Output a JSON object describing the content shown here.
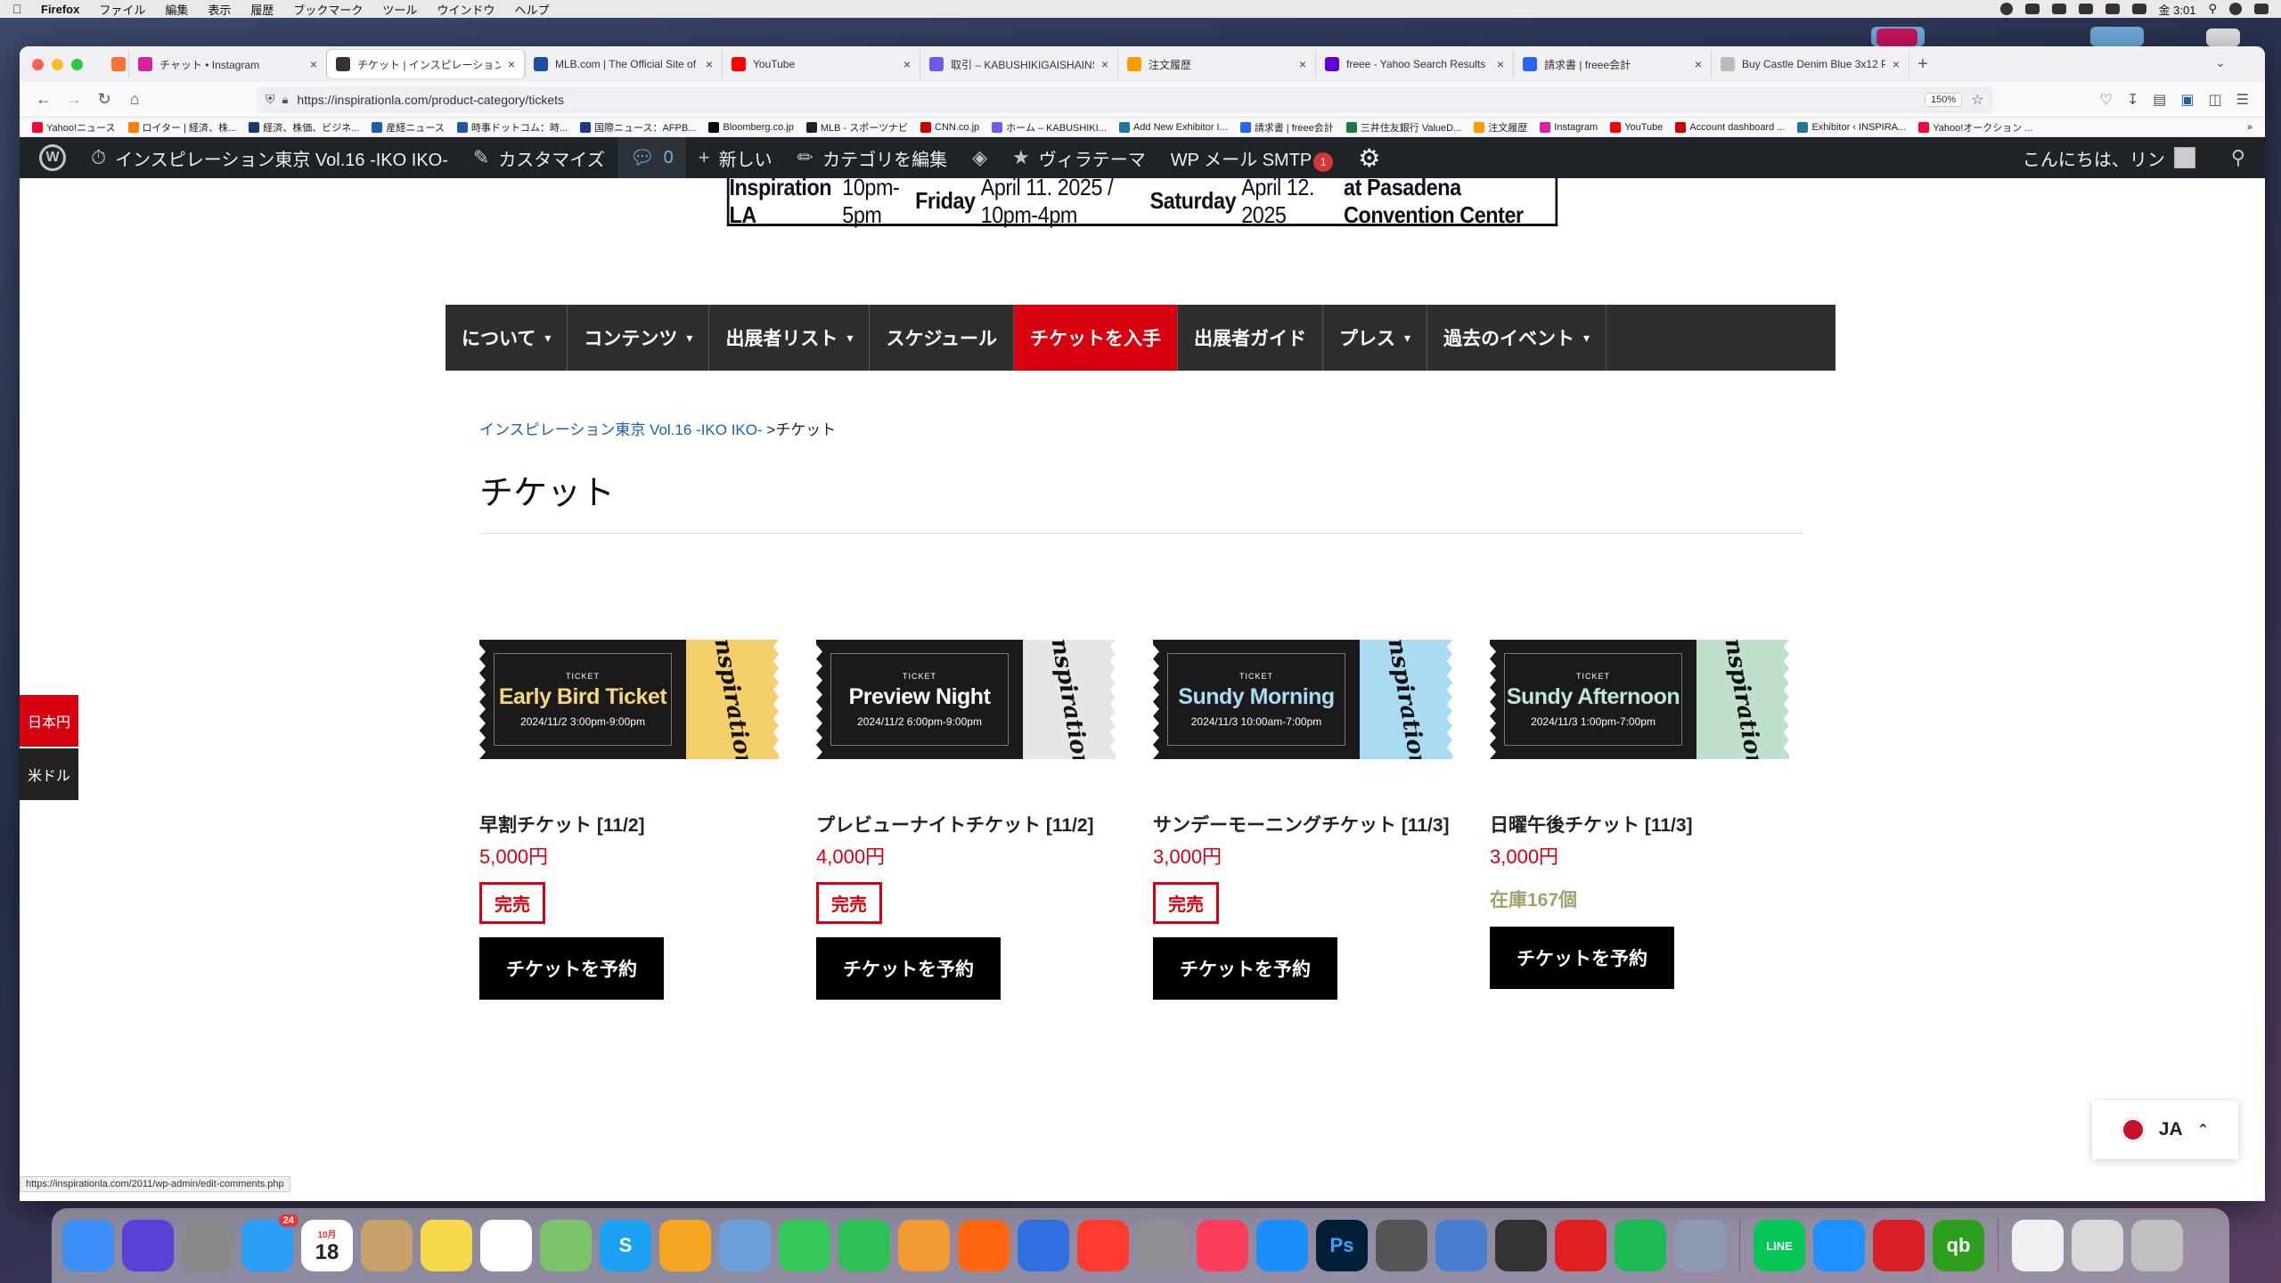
{
  "menubar": {
    "app": "Firefox",
    "menus": [
      "ファイル",
      "編集",
      "表示",
      "履歴",
      "ブックマーク",
      "ツール",
      "ウインドウ",
      "ヘルプ"
    ],
    "clock": "金 3:01"
  },
  "browser": {
    "tabs": [
      {
        "label": "",
        "color": "#ff7139"
      },
      {
        "label": "チャット • Instagram",
        "color": "#d6249f"
      },
      {
        "label": "チケット | インスピレーション東",
        "color": "#333333",
        "active": true
      },
      {
        "label": "MLB.com | The Official Site of M",
        "color": "#1b4f9c"
      },
      {
        "label": "YouTube",
        "color": "#ff0000"
      },
      {
        "label": "取引 – KABUSHIKIGAISHAINSPI",
        "color": "#6b5ce7"
      },
      {
        "label": "注文履歴",
        "color": "#ff9900"
      },
      {
        "label": "freee - Yahoo Search Results",
        "color": "#6001d2"
      },
      {
        "label": "請求書 | freee会計",
        "color": "#2864f0"
      },
      {
        "label": "Buy Castle Denim Blue 3x12 Po",
        "color": "#bbbbbb"
      }
    ],
    "url": "https://inspirationla.com/product-category/tickets",
    "zoom": "150%",
    "bookmarks": [
      {
        "label": "Yahoo!ニュース",
        "color": "#ff0033"
      },
      {
        "label": "ロイター | 経済、株...",
        "color": "#ff8000"
      },
      {
        "label": "経済、株価、ビジネ...",
        "color": "#1a3a6e"
      },
      {
        "label": "産経ニュース",
        "color": "#1a5fb4"
      },
      {
        "label": "時事ドットコム：時...",
        "color": "#2255aa"
      },
      {
        "label": "国際ニュース：AFPB...",
        "color": "#1a3a8e"
      },
      {
        "label": "Bloomberg.co.jp",
        "color": "#000000"
      },
      {
        "label": "MLB - スポーツナビ",
        "color": "#222222"
      },
      {
        "label": "CNN.co.jp",
        "color": "#cc0000"
      },
      {
        "label": "ホーム – KABUSHIKI...",
        "color": "#6b5ce7"
      },
      {
        "label": "Add New Exhibitor I...",
        "color": "#21759b"
      },
      {
        "label": "請求書 | freee会計",
        "color": "#2864f0"
      },
      {
        "label": "三井住友銀行 ValueD...",
        "color": "#1e7a3c"
      },
      {
        "label": "注文履歴",
        "color": "#ff9900"
      },
      {
        "label": "Instagram",
        "color": "#d6249f"
      },
      {
        "label": "YouTube",
        "color": "#ff0000"
      },
      {
        "label": "Account dashboard ...",
        "color": "#cc0000"
      },
      {
        "label": "Exhibitor ‹ INSPIRA...",
        "color": "#21759b"
      },
      {
        "label": "Yahoo!オークション ...",
        "color": "#ff0033"
      }
    ],
    "status_url": "https://inspirationla.com/2011/wp-admin/edit-comments.php"
  },
  "wpbar": {
    "site": "インスピレーション東京 Vol.16 -IKO IKO-",
    "customize": "カスタマイズ",
    "comments": "0",
    "new": "新しい",
    "edit_category": "カテゴリを編集",
    "theme": "ヴィラテーマ",
    "smtp": "WP メール SMTP",
    "smtp_badge": "1",
    "greeting": "こんにちは、リン"
  },
  "banner": {
    "brand": "Inspiration LA",
    "time1": "10pm-5pm",
    "day1": "Friday",
    "date1": "April 11. 2025 / 10pm-4pm",
    "day2": "Saturday",
    "date2": "April 12. 2025",
    "venue": "at Pasadena Convention Center"
  },
  "nav": [
    {
      "label": "について",
      "dropdown": true
    },
    {
      "label": "コンテンツ",
      "dropdown": true
    },
    {
      "label": "出展者リスト",
      "dropdown": true
    },
    {
      "label": "スケジュール",
      "dropdown": false
    },
    {
      "label": "チケットを入手",
      "dropdown": false,
      "active": true
    },
    {
      "label": "出展者ガイド",
      "dropdown": false
    },
    {
      "label": "プレス",
      "dropdown": true
    },
    {
      "label": "過去のイベント",
      "dropdown": true
    }
  ],
  "breadcrumb": {
    "home": "インスピレーション東京 Vol.16 -IKO IKO-",
    "sep": " >",
    "current": "チケット"
  },
  "page_title": "チケット",
  "currency": {
    "jpy": "日本円",
    "usd": "米ドル"
  },
  "products": [
    {
      "ticket_label": "TICKET",
      "ticket_name": "Early Bird Ticket",
      "ticket_date": "2024/11/2  3:00pm-9:00pm",
      "name_color": "#f5d77a",
      "stub_color": "#f5cf6b",
      "name": "早割チケット [11/2]",
      "price": "5,000円",
      "status": "完売",
      "button": "チケットを予約"
    },
    {
      "ticket_label": "TICKET",
      "ticket_name": "Preview Night",
      "ticket_date": "2024/11/2  6:00pm-9:00pm",
      "name_color": "#ffffff",
      "stub_color": "#e6e6e6",
      "name": "プレビューナイトチケット [11/2]",
      "price": "4,000円",
      "status": "完売",
      "button": "チケットを予約"
    },
    {
      "ticket_label": "TICKET",
      "ticket_name": "Sundy Morning",
      "ticket_date": "2024/11/3  10:00am-7:00pm",
      "name_color": "#a9dcf3",
      "stub_color": "#a9dcf3",
      "name": "サンデーモーニングチケット [11/3]",
      "price": "3,000円",
      "status": "完売",
      "button": "チケットを予約"
    },
    {
      "ticket_label": "TICKET",
      "ticket_name": "Sundy Afternoon",
      "ticket_date": "2024/11/3  1:00pm-7:00pm",
      "name_color": "#bfe6d2",
      "stub_color": "#bfe0cc",
      "name": "日曜午後チケット [11/3]",
      "price": "3,000円",
      "stock": "在庫167個",
      "button": "チケットを予約"
    }
  ],
  "language": {
    "code": "JA"
  },
  "dock_icons": [
    "finder-icon",
    "siri-icon",
    "launchpad-icon",
    "messages-icon",
    "calendar-icon",
    "contacts-icon",
    "notes-icon",
    "reminders-icon",
    "maps-icon",
    "skype-icon",
    "photos-icon",
    "preview-icon",
    "facetime-icon",
    "numbers-icon",
    "pages-icon",
    "firefox-icon",
    "keynote-icon",
    "news-icon",
    "system-preferences-icon",
    "music-icon",
    "app-store-icon",
    "photoshop-icon",
    "screenshot-icon",
    "preview-2-icon",
    "camera-icon",
    "acrobat-icon",
    "spotify-icon",
    "image-capture-icon",
    "line-icon",
    "safari-icon",
    "creative-cloud-icon",
    "quickbooks-icon",
    "document-icon",
    "folder-icon",
    "trash-icon"
  ],
  "dock": {
    "messages_badge": "24",
    "calendar_month": "10月",
    "calendar_day": "18"
  }
}
